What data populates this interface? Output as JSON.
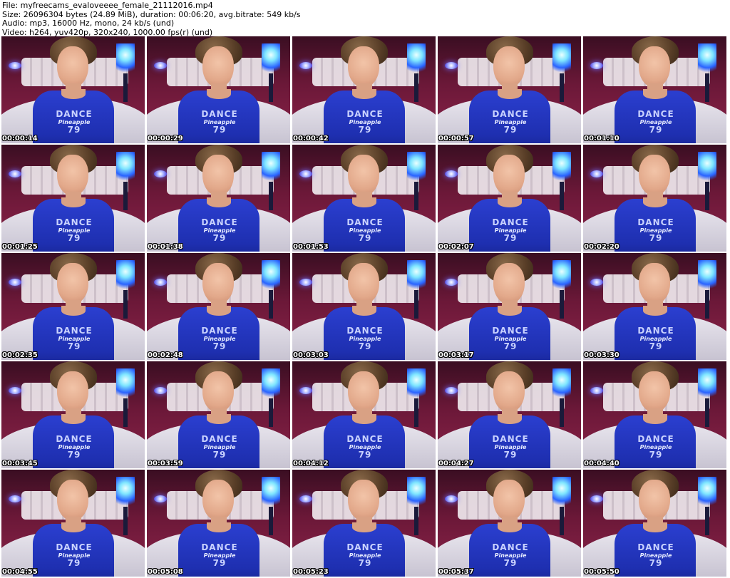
{
  "header": {
    "file_line": "File: myfreecams_evaloveeee_female_21112016.mp4",
    "size_line": "Size: 26096304 bytes (24.89 MiB), duration: 00:06:20, avg.bitrate: 549 kb/s",
    "audio_line": "Audio: mp3, 16000 Hz, mono, 24 kb/s (und)",
    "video_line": "Video: h264, yuv420p, 320x240, 1000.00 fps(r) (und)"
  },
  "thumbnails": [
    "00:00:14",
    "00:00:29",
    "00:00:42",
    "00:00:57",
    "00:01:10",
    "00:01:25",
    "00:01:38",
    "00:01:53",
    "00:02:07",
    "00:02:20",
    "00:02:35",
    "00:02:48",
    "00:03:03",
    "00:03:17",
    "00:03:30",
    "00:03:45",
    "00:03:59",
    "00:04:12",
    "00:04:27",
    "00:04:40",
    "00:04:55",
    "00:05:08",
    "00:05:23",
    "00:05:37",
    "00:05:50"
  ],
  "shirt_print": {
    "line1": "DANCE",
    "line2": "Pineapple",
    "line3": "79"
  }
}
